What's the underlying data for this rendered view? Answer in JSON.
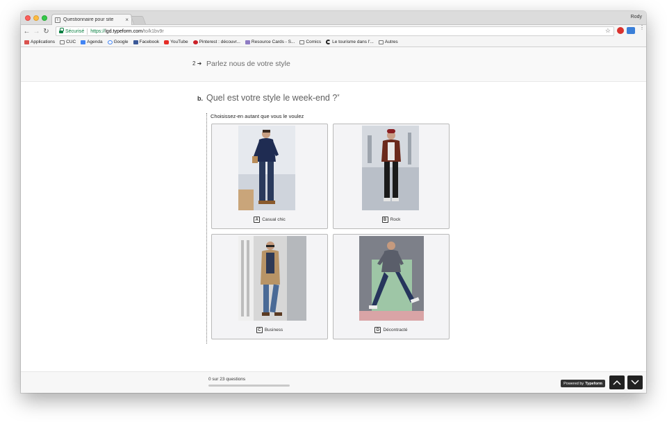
{
  "browser": {
    "tab_title": "Questionnaire pour site",
    "tab_favicon": "t",
    "tab_close": "×",
    "profile_name": "Rody",
    "secure_label": "Sécurisé",
    "url_scheme": "https://",
    "url_host": "lgd.typeform.com",
    "url_path": "/to/k1bv9r"
  },
  "bookmarks": [
    {
      "label": "Applications",
      "icon": "apps-grid-icon",
      "color": "#d9534f"
    },
    {
      "label": "CUC",
      "icon": "folder-icon",
      "color": "#777777"
    },
    {
      "label": "Agenda",
      "icon": "calendar-icon",
      "color": "#4285f4"
    },
    {
      "label": "Google",
      "icon": "google-icon",
      "color": "#4285f4"
    },
    {
      "label": "Facebook",
      "icon": "facebook-icon",
      "color": "#3b5998"
    },
    {
      "label": "YouTube",
      "icon": "youtube-icon",
      "color": "#e52d27"
    },
    {
      "label": "Pinterest : découvr...",
      "icon": "pinterest-icon",
      "color": "#cb2027"
    },
    {
      "label": "Resource Cards - S...",
      "icon": "resource-cards-icon",
      "color": "#8e7cc3"
    },
    {
      "label": "Comics",
      "icon": "folder-icon",
      "color": "#777777"
    },
    {
      "label": "Le tourisme dans l'...",
      "icon": "c-logo-icon",
      "color": "#222222"
    },
    {
      "label": "Autres",
      "icon": "folder-icon",
      "color": "#777777"
    }
  ],
  "previous_question": {
    "number": "2",
    "text": "Parlez nous de votre style"
  },
  "question": {
    "letter": "b.",
    "text": "Quel est votre style le week-end ?",
    "required_mark": "*",
    "hint": "Choisissez-en autant que vous le voulez"
  },
  "choices": [
    {
      "key": "A",
      "label": "Casual chic"
    },
    {
      "key": "B",
      "label": "Rock"
    },
    {
      "key": "C",
      "label": "Business"
    },
    {
      "key": "D",
      "label": "Décontracté"
    }
  ],
  "footer": {
    "progress_text": "0 sur 23 questions",
    "progress_fraction": 0,
    "powered_prefix": "Powered by",
    "powered_brand": "Typeform"
  }
}
